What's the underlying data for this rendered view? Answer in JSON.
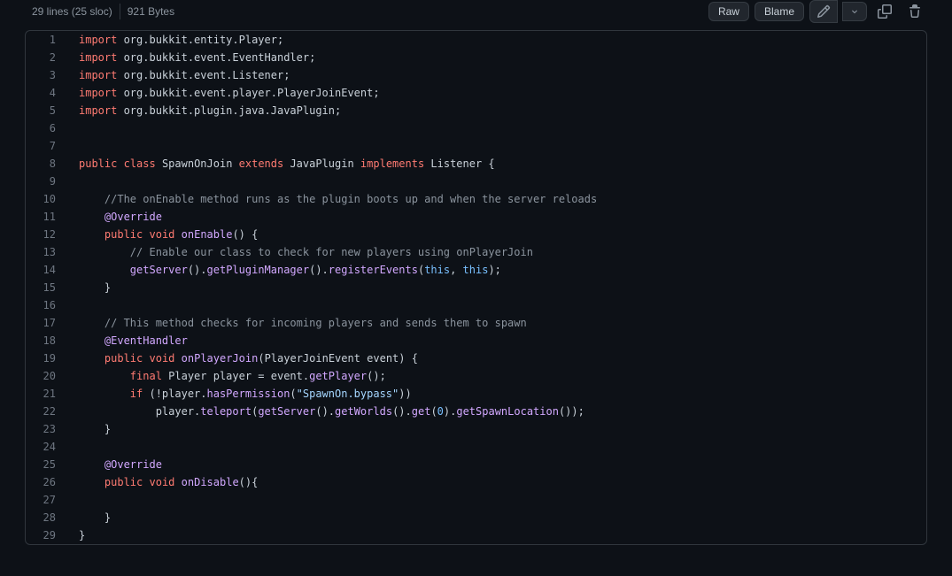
{
  "header": {
    "lines_info": "29 lines (25 sloc)",
    "bytes_info": "921 Bytes",
    "raw_label": "Raw",
    "blame_label": "Blame"
  },
  "code": {
    "lines": [
      {
        "n": 1,
        "t": [
          [
            "kw",
            "import"
          ],
          [
            "",
            " org.bukkit.entity.Player;"
          ]
        ]
      },
      {
        "n": 2,
        "t": [
          [
            "kw",
            "import"
          ],
          [
            "",
            " org.bukkit.event.EventHandler;"
          ]
        ]
      },
      {
        "n": 3,
        "t": [
          [
            "kw",
            "import"
          ],
          [
            "",
            " org.bukkit.event.Listener;"
          ]
        ]
      },
      {
        "n": 4,
        "t": [
          [
            "kw",
            "import"
          ],
          [
            "",
            " org.bukkit.event.player.PlayerJoinEvent;"
          ]
        ]
      },
      {
        "n": 5,
        "t": [
          [
            "kw",
            "import"
          ],
          [
            "",
            " org.bukkit.plugin.java.JavaPlugin;"
          ]
        ]
      },
      {
        "n": 6,
        "t": [
          [
            "",
            ""
          ]
        ]
      },
      {
        "n": 7,
        "t": [
          [
            "",
            ""
          ]
        ]
      },
      {
        "n": 8,
        "t": [
          [
            "kw",
            "public"
          ],
          [
            "",
            " "
          ],
          [
            "kw",
            "class"
          ],
          [
            "",
            " SpawnOnJoin "
          ],
          [
            "kw",
            "extends"
          ],
          [
            "",
            " JavaPlugin "
          ],
          [
            "kw",
            "implements"
          ],
          [
            "",
            " Listener {"
          ]
        ]
      },
      {
        "n": 9,
        "t": [
          [
            "",
            ""
          ]
        ]
      },
      {
        "n": 10,
        "t": [
          [
            "",
            "    "
          ],
          [
            "cmt",
            "//The onEnable method runs as the plugin boots up and when the server reloads"
          ]
        ]
      },
      {
        "n": 11,
        "t": [
          [
            "",
            "    "
          ],
          [
            "fn",
            "@Override"
          ]
        ]
      },
      {
        "n": 12,
        "t": [
          [
            "",
            "    "
          ],
          [
            "kw",
            "public"
          ],
          [
            "",
            " "
          ],
          [
            "kw",
            "void"
          ],
          [
            "",
            " "
          ],
          [
            "fn",
            "onEnable"
          ],
          [
            "",
            "() {"
          ]
        ]
      },
      {
        "n": 13,
        "t": [
          [
            "",
            "        "
          ],
          [
            "cmt",
            "// Enable our class to check for new players using onPlayerJoin"
          ]
        ]
      },
      {
        "n": 14,
        "t": [
          [
            "",
            "        "
          ],
          [
            "fn",
            "getServer"
          ],
          [
            "",
            "()."
          ],
          [
            "fn",
            "getPluginManager"
          ],
          [
            "",
            "()."
          ],
          [
            "fn",
            "registerEvents"
          ],
          [
            "",
            "("
          ],
          [
            "const",
            "this"
          ],
          [
            "",
            ", "
          ],
          [
            "const",
            "this"
          ],
          [
            "",
            ");"
          ]
        ]
      },
      {
        "n": 15,
        "t": [
          [
            "",
            "    }"
          ]
        ]
      },
      {
        "n": 16,
        "t": [
          [
            "",
            ""
          ]
        ]
      },
      {
        "n": 17,
        "t": [
          [
            "",
            "    "
          ],
          [
            "cmt",
            "// This method checks for incoming players and sends them to spawn"
          ]
        ]
      },
      {
        "n": 18,
        "t": [
          [
            "",
            "    "
          ],
          [
            "fn",
            "@EventHandler"
          ]
        ]
      },
      {
        "n": 19,
        "t": [
          [
            "",
            "    "
          ],
          [
            "kw",
            "public"
          ],
          [
            "",
            " "
          ],
          [
            "kw",
            "void"
          ],
          [
            "",
            " "
          ],
          [
            "fn",
            "onPlayerJoin"
          ],
          [
            "",
            "(PlayerJoinEvent event) {"
          ]
        ]
      },
      {
        "n": 20,
        "t": [
          [
            "",
            "        "
          ],
          [
            "kw",
            "final"
          ],
          [
            "",
            " Player player = event."
          ],
          [
            "fn",
            "getPlayer"
          ],
          [
            "",
            "();"
          ]
        ]
      },
      {
        "n": 21,
        "t": [
          [
            "",
            "        "
          ],
          [
            "kw",
            "if"
          ],
          [
            "",
            " (!player."
          ],
          [
            "fn",
            "hasPermission"
          ],
          [
            "",
            "("
          ],
          [
            "str",
            "\"SpawnOn.bypass\""
          ],
          [
            "",
            ")) "
          ]
        ]
      },
      {
        "n": 22,
        "t": [
          [
            "",
            "            player."
          ],
          [
            "fn",
            "teleport"
          ],
          [
            "",
            "("
          ],
          [
            "fn",
            "getServer"
          ],
          [
            "",
            "()."
          ],
          [
            "fn",
            "getWorlds"
          ],
          [
            "",
            "()."
          ],
          [
            "fn",
            "get"
          ],
          [
            "",
            "("
          ],
          [
            "num",
            "0"
          ],
          [
            "",
            ")."
          ],
          [
            "fn",
            "getSpawnLocation"
          ],
          [
            "",
            "());"
          ]
        ]
      },
      {
        "n": 23,
        "t": [
          [
            "",
            "    }"
          ]
        ]
      },
      {
        "n": 24,
        "t": [
          [
            "",
            ""
          ]
        ]
      },
      {
        "n": 25,
        "t": [
          [
            "",
            "    "
          ],
          [
            "fn",
            "@Override"
          ]
        ]
      },
      {
        "n": 26,
        "t": [
          [
            "",
            "    "
          ],
          [
            "kw",
            "public"
          ],
          [
            "",
            " "
          ],
          [
            "kw",
            "void"
          ],
          [
            "",
            " "
          ],
          [
            "fn",
            "onDisable"
          ],
          [
            "",
            "(){"
          ]
        ]
      },
      {
        "n": 27,
        "t": [
          [
            "",
            ""
          ]
        ]
      },
      {
        "n": 28,
        "t": [
          [
            "",
            "    }"
          ]
        ]
      },
      {
        "n": 29,
        "t": [
          [
            "",
            "}"
          ]
        ]
      }
    ]
  }
}
